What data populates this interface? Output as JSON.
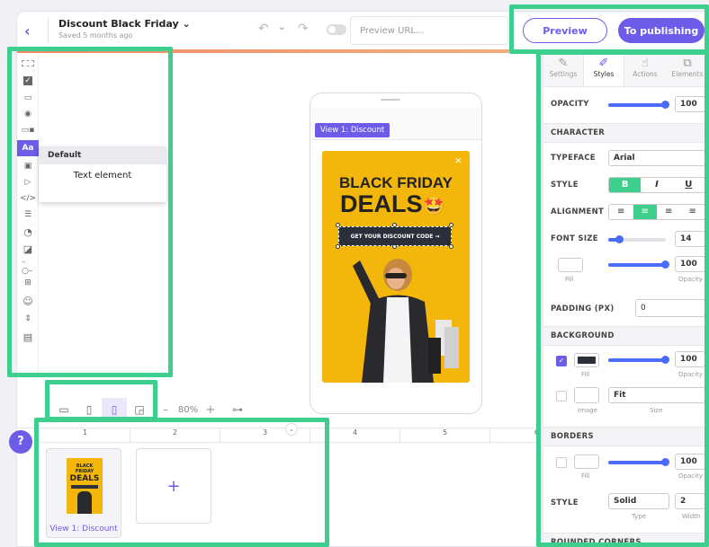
{
  "header": {
    "back": "‹",
    "title": "Discount Black Friday",
    "title_chevron": "⌄",
    "subtitle": "Saved 5 months ago",
    "undo": "↶",
    "redo": "↷",
    "preview_placeholder": "Preview URL...",
    "preview_button": "Preview",
    "publish_button": "To publishing"
  },
  "colors": {
    "accent": "#6c5ce7",
    "highlight": "#3ecf8e",
    "slider": "#4a6cf7"
  },
  "tools": [
    "dotted-box-icon",
    "checkbox-icon",
    "input-icon",
    "radio-icon",
    "toggle-icon",
    "text-icon",
    "image-icon",
    "video-icon",
    "code-icon",
    "form-icon",
    "timer-icon",
    "shapes-icon",
    "divider-icon",
    "grid-icon",
    "emoji-icon",
    "stepper-icon",
    "calendar-icon"
  ],
  "tool_text": "Aa",
  "text_menu": {
    "title": "Default",
    "item": "Text element"
  },
  "canvas": {
    "view_tag": "View 1: Discount",
    "promo_title": "BLACK FRIDAY",
    "promo_deals": "DEALS",
    "promo_emoji": "🤩",
    "promo_button": "GET YOUR DISCOUNT CODE →",
    "close": "×"
  },
  "device_bar": {
    "zoom": "80%",
    "minus": "–",
    "plus": "+"
  },
  "timeline": {
    "cols": [
      "1",
      "2",
      "3",
      "4",
      "5",
      "6"
    ],
    "thumb_title": "BLACK FRIDAY",
    "thumb_deals": "DEALS",
    "thumb_label": "View 1: Discount",
    "add": "+",
    "help": "?"
  },
  "panel": {
    "tabs": [
      "Settings",
      "Styles",
      "Actions",
      "Elements"
    ],
    "opacity_label": "OPACITY",
    "opacity_value": "100",
    "opacity_level": 1.0,
    "character": "CHARACTER",
    "typeface_label": "TYPEFACE",
    "typeface_value": "Arial",
    "style_label": "STYLE",
    "style_bold": "B",
    "style_italic": "I",
    "style_underline": "U",
    "alignment_label": "ALIGNMENT",
    "fontsize_label": "FONT SIZE",
    "fontsize_value": "14",
    "fontsize_level": 0.15,
    "fill_label": "Fill",
    "opacity_small": "Opacity",
    "fill_opacity": "100",
    "padding_label": "PADDING (PX)",
    "padding_value": "0",
    "background": "BACKGROUND",
    "bg_opacity": "100",
    "image_label": "Image",
    "size_label": "Size",
    "size_value": "Fit",
    "borders": "BORDERS",
    "border_opacity": "100",
    "border_style_label": "STYLE",
    "border_style_value": "Solid",
    "border_width_value": "2",
    "type_label": "Type",
    "width_label": "Width",
    "rounded": "ROUNDED CORNERS"
  }
}
